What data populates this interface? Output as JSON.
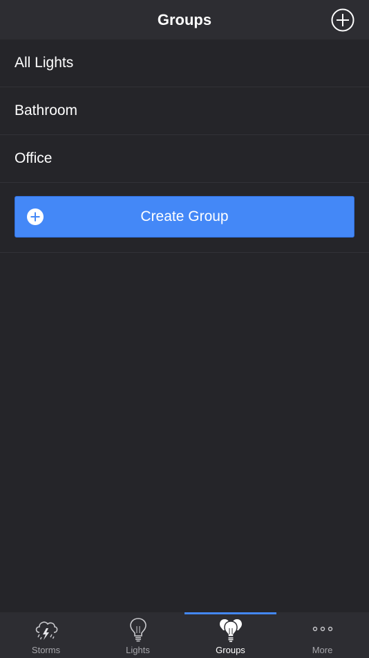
{
  "navbar": {
    "title": "Groups",
    "add_icon": "plus-circle-icon"
  },
  "groups": [
    {
      "label": "All Lights"
    },
    {
      "label": "Bathroom"
    },
    {
      "label": "Office"
    }
  ],
  "create_button": {
    "label": "Create Group",
    "icon": "plus-circle-icon"
  },
  "tabbar": {
    "active_tab": "Groups",
    "accent_color": "#4488f7",
    "tabs": [
      {
        "label": "Storms",
        "icon": "storm-cloud-icon"
      },
      {
        "label": "Lights",
        "icon": "lightbulb-icon"
      },
      {
        "label": "Groups",
        "icon": "lightbulb-group-icon"
      },
      {
        "label": "More",
        "icon": "more-dots-icon"
      }
    ]
  }
}
